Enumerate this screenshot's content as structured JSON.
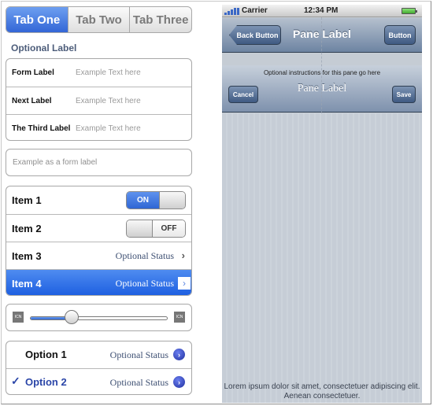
{
  "tabs": [
    "Tab One",
    "Tab Two",
    "Tab Three"
  ],
  "active_tab": 0,
  "optional_label": "Optional Label",
  "form_rows": [
    {
      "label": "Form Label",
      "placeholder": "Example Text here"
    },
    {
      "label": "Next Label",
      "placeholder": "Example Text here"
    },
    {
      "label": "The Third Label",
      "placeholder": "Example Text here"
    }
  ],
  "form_field_placeholder": "Example as a form label",
  "items": [
    {
      "label": "Item 1",
      "toggle": "ON"
    },
    {
      "label": "Item 2",
      "toggle": "OFF"
    },
    {
      "label": "Item 3",
      "status": "Optional Status"
    },
    {
      "label": "Item 4",
      "status": "Optional Status",
      "selected": true
    }
  ],
  "slider": {
    "left_icon": "ICN",
    "right_icon": "ICN",
    "value_fraction": 0.3
  },
  "options": [
    {
      "label": "Option 1",
      "status": "Optional Status",
      "checked": false
    },
    {
      "label": "Option 2",
      "status": "Optional Status",
      "checked": true
    }
  ],
  "phone": {
    "carrier": "Carrier",
    "time": "12:34 PM",
    "nav1": {
      "back": "Back Button",
      "title": "Pane Label",
      "button": "Button"
    },
    "nav2": {
      "instructions": "Optional instructions for this pane go here",
      "title": "Pane Label",
      "cancel": "Cancel",
      "save": "Save"
    },
    "footer": "Lorem ipsum dolor sit amet, consectetuer adipiscing elit. Aenean consectetuer."
  },
  "colors": {
    "accent": "#3366d6",
    "nav": "#6d84a2",
    "content_bg": "#c6cdd6"
  }
}
